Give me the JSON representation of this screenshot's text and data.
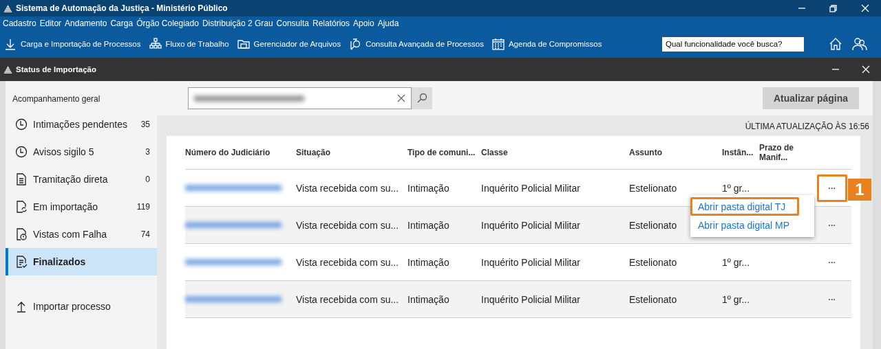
{
  "window": {
    "title": "Sistema de Automação da Justiça - Ministério Público"
  },
  "menu_bar": [
    "Cadastro",
    "Editor",
    "Andamento",
    "Carga",
    "Órgão Colegiado",
    "Distribuição 2 Grau",
    "Consulta",
    "Relatórios",
    "Apoio",
    "Ajuda"
  ],
  "toolbar": [
    {
      "label": "Carga e Importação de Processos"
    },
    {
      "label": "Fluxo de Trabalho"
    },
    {
      "label": "Gerenciador de Arquivos"
    },
    {
      "label": "Consulta Avançada de Processos"
    },
    {
      "label": "Agenda de Compromissos"
    }
  ],
  "search": {
    "placeholder": "Qual funcionalidade você busca?"
  },
  "subwindow": {
    "title": "Status de Importação"
  },
  "sidebar": {
    "heading": "Acompanhamento geral",
    "items": [
      {
        "label": "Intimações pendentes",
        "count": "35",
        "selected": false
      },
      {
        "label": "Avisos sigilo 5",
        "count": "3",
        "selected": false
      },
      {
        "label": "Tramitação direta",
        "count": "0",
        "selected": false
      },
      {
        "label": "Em importação",
        "count": "119",
        "selected": false
      },
      {
        "label": "Vistas com Falha",
        "count": "74",
        "selected": false
      },
      {
        "label": "Finalizados",
        "selected": true
      }
    ],
    "import_action": "Importar processo"
  },
  "refresh_button": "Atualizar página",
  "last_update": "ÚLTIMA ATUALIZAÇÃO ÀS 16:56",
  "table": {
    "columns": [
      "Número do Judiciário",
      "Situação",
      "Tipo de comuni...",
      "Classe",
      "Assunto",
      "Instân...",
      "Prazo de Manif..."
    ],
    "rows": [
      {
        "situation": "Vista recebida com su...",
        "communication_type": "Intimação",
        "class": "Inquérito Policial Militar",
        "subject": "Estelionato",
        "instance": "1º gr...",
        "actions": "···",
        "highlighted": true
      },
      {
        "situation": "Vista recebida com su...",
        "communication_type": "Intimação",
        "class": "Inquérito Policial Militar",
        "subject": "Estelionato",
        "actions": "···",
        "highlighted": false
      },
      {
        "situation": "Vista recebida com su...",
        "communication_type": "Intimação",
        "class": "Inquérito Policial Militar",
        "subject": "Estelionato",
        "instance": "1º gr...",
        "actions": "···",
        "highlighted": false
      },
      {
        "situation": "Vista recebida com su...",
        "communication_type": "Intimação",
        "class": "Inquérito Policial Militar",
        "subject": "Estelionato",
        "instance": "1º gr...",
        "actions": "···",
        "highlighted": false
      }
    ]
  },
  "context_menu": {
    "items": [
      {
        "label": "Abrir pasta digital TJ",
        "highlighted": true
      },
      {
        "label": "Abrir pasta digital MP",
        "highlighted": false
      }
    ]
  },
  "annotation": {
    "label": "1"
  }
}
